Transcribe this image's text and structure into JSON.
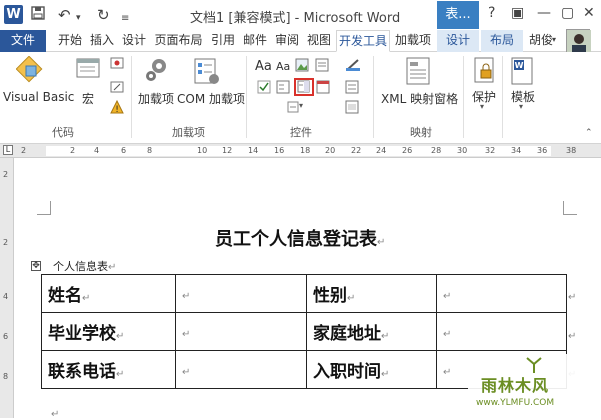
{
  "window": {
    "title": "文档1 [兼容模式] - Microsoft Word",
    "context_tab_header": "表...",
    "user_name": "胡俊"
  },
  "tabs": [
    {
      "label": "文件"
    },
    {
      "label": "开始"
    },
    {
      "label": "插入"
    },
    {
      "label": "设计"
    },
    {
      "label": "页面布局"
    },
    {
      "label": "引用"
    },
    {
      "label": "邮件"
    },
    {
      "label": "审阅"
    },
    {
      "label": "视图"
    },
    {
      "label": "开发工具"
    },
    {
      "label": "加载项"
    },
    {
      "label": "设计"
    },
    {
      "label": "布局"
    }
  ],
  "ribbon": {
    "code_group": {
      "label": "代码",
      "visual_basic": "Visual Basic",
      "macro": "宏"
    },
    "addins_group": {
      "label": "加载项",
      "addins": "加载项",
      "com_addins": "COM 加载项"
    },
    "controls_group": {
      "label": "控件",
      "aa1": "Aa",
      "aa2": "Aa"
    },
    "mapping_group": {
      "label": "映射",
      "xml_pane": "XML 映射窗格"
    },
    "protect": {
      "label": "保护"
    },
    "template": {
      "label": "模板"
    }
  },
  "ruler": {
    "h_numbers": [
      "2",
      "2",
      "4",
      "6",
      "8",
      "10",
      "12",
      "14",
      "16",
      "18",
      "20",
      "22",
      "24",
      "26",
      "28",
      "30",
      "32",
      "34",
      "36",
      "38"
    ],
    "v_numbers": [
      "2",
      "2",
      "4",
      "6",
      "8"
    ]
  },
  "document": {
    "title": "员工个人信息登记表",
    "caption": "个人信息表",
    "table": [
      [
        "姓名",
        "",
        "性别",
        ""
      ],
      [
        "毕业学校",
        "",
        "家庭地址",
        ""
      ],
      [
        "联系电话",
        "",
        "入职时间",
        ""
      ]
    ]
  },
  "watermark": {
    "title": "雨林木风",
    "url": "www.YLMFU.COM"
  },
  "colors": {
    "word_blue": "#2b579a",
    "context_tab": "#3a7fc2",
    "highlight_red": "#d9312b"
  }
}
